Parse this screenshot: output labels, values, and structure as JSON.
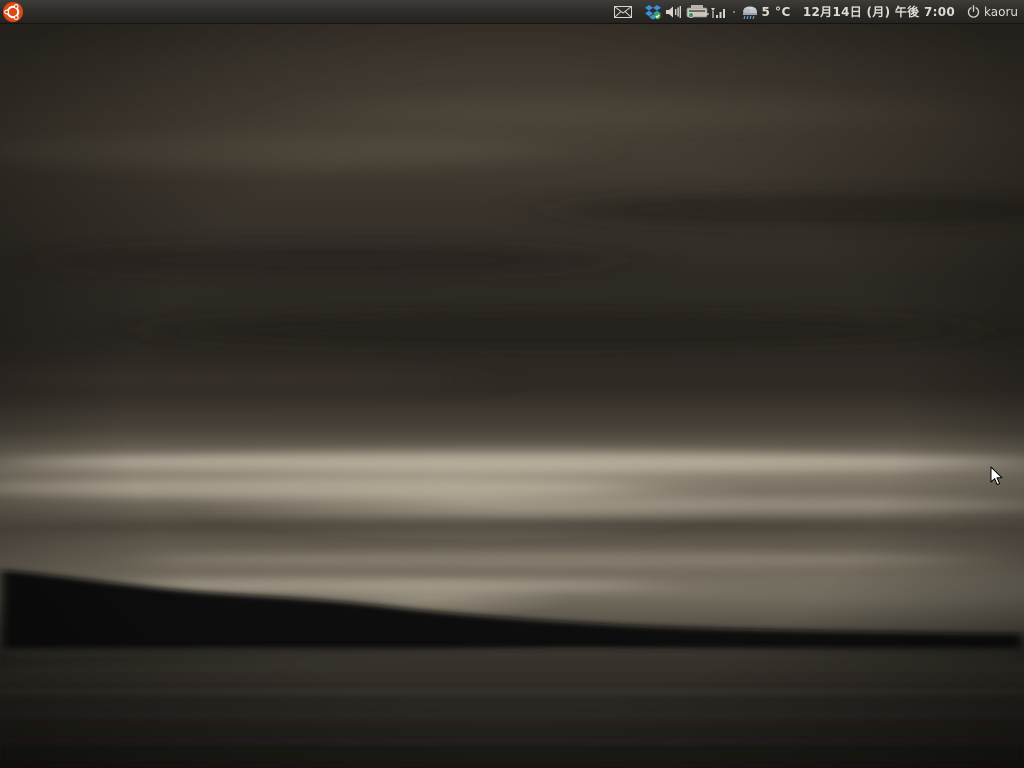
{
  "panel": {
    "app_menu_icon": "ubuntu-logo-icon",
    "indicators": {
      "mail_icon": "envelope-icon",
      "dropbox_icon": "dropbox-icon",
      "volume_icon": "speaker-icon",
      "network_icon": "wired-network-icon",
      "signal_icon": "signal-bars-icon",
      "weather_icon": "rain-cloud-icon",
      "weather_temp": "5 °C",
      "power_icon": "power-icon"
    },
    "clock": "12月14日 (月) 午後 7:00",
    "user_name": "kaoru"
  },
  "colors": {
    "panel_bg": "#2d2c28",
    "panel_text": "#dfdbd2",
    "ubuntu_orange": "#dd4814",
    "dropbox_blue": "#3a8fd6"
  }
}
